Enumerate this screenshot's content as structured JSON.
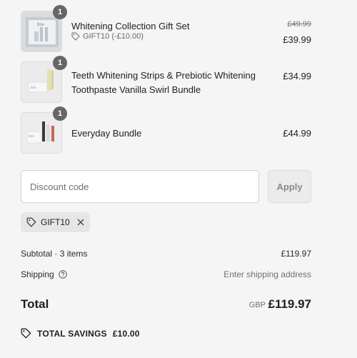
{
  "items": [
    {
      "title_lines": [
        "Whitening Collection Gift Set"
      ],
      "quantity": "1",
      "discount_label": "GIFT10 (-£10.00)",
      "original_price": "£49.99",
      "price": "£39.99",
      "thumb_icon": "gift-set-product-image"
    },
    {
      "title_lines": [
        "Teeth Whitening Strips & Prebiotic Whitening",
        "Toothpaste Vanilla Swirl Bundle"
      ],
      "quantity": "1",
      "price": "£34.99",
      "thumb_icon": "strips-toothpaste-product-image"
    },
    {
      "title_lines": [
        "Everyday Bundle"
      ],
      "quantity": "1",
      "price": "£44.99",
      "thumb_icon": "everyday-bundle-product-image"
    }
  ],
  "discount": {
    "placeholder": "Discount code",
    "apply_label": "Apply",
    "applied_code": "GIFT10"
  },
  "summary": {
    "subtotal_label": "Subtotal · 3 items",
    "subtotal_value": "£119.97",
    "shipping_label": "Shipping",
    "shipping_value": "Enter shipping address",
    "total_label": "Total",
    "currency": "GBP",
    "total_value": "£119.97",
    "savings_label": "TOTAL SAVINGS",
    "savings_value": "£10.00"
  },
  "colors": {
    "background": "#f5f5f5",
    "badge": "#666666",
    "text": "#1f1f1f",
    "muted": "#707070"
  }
}
